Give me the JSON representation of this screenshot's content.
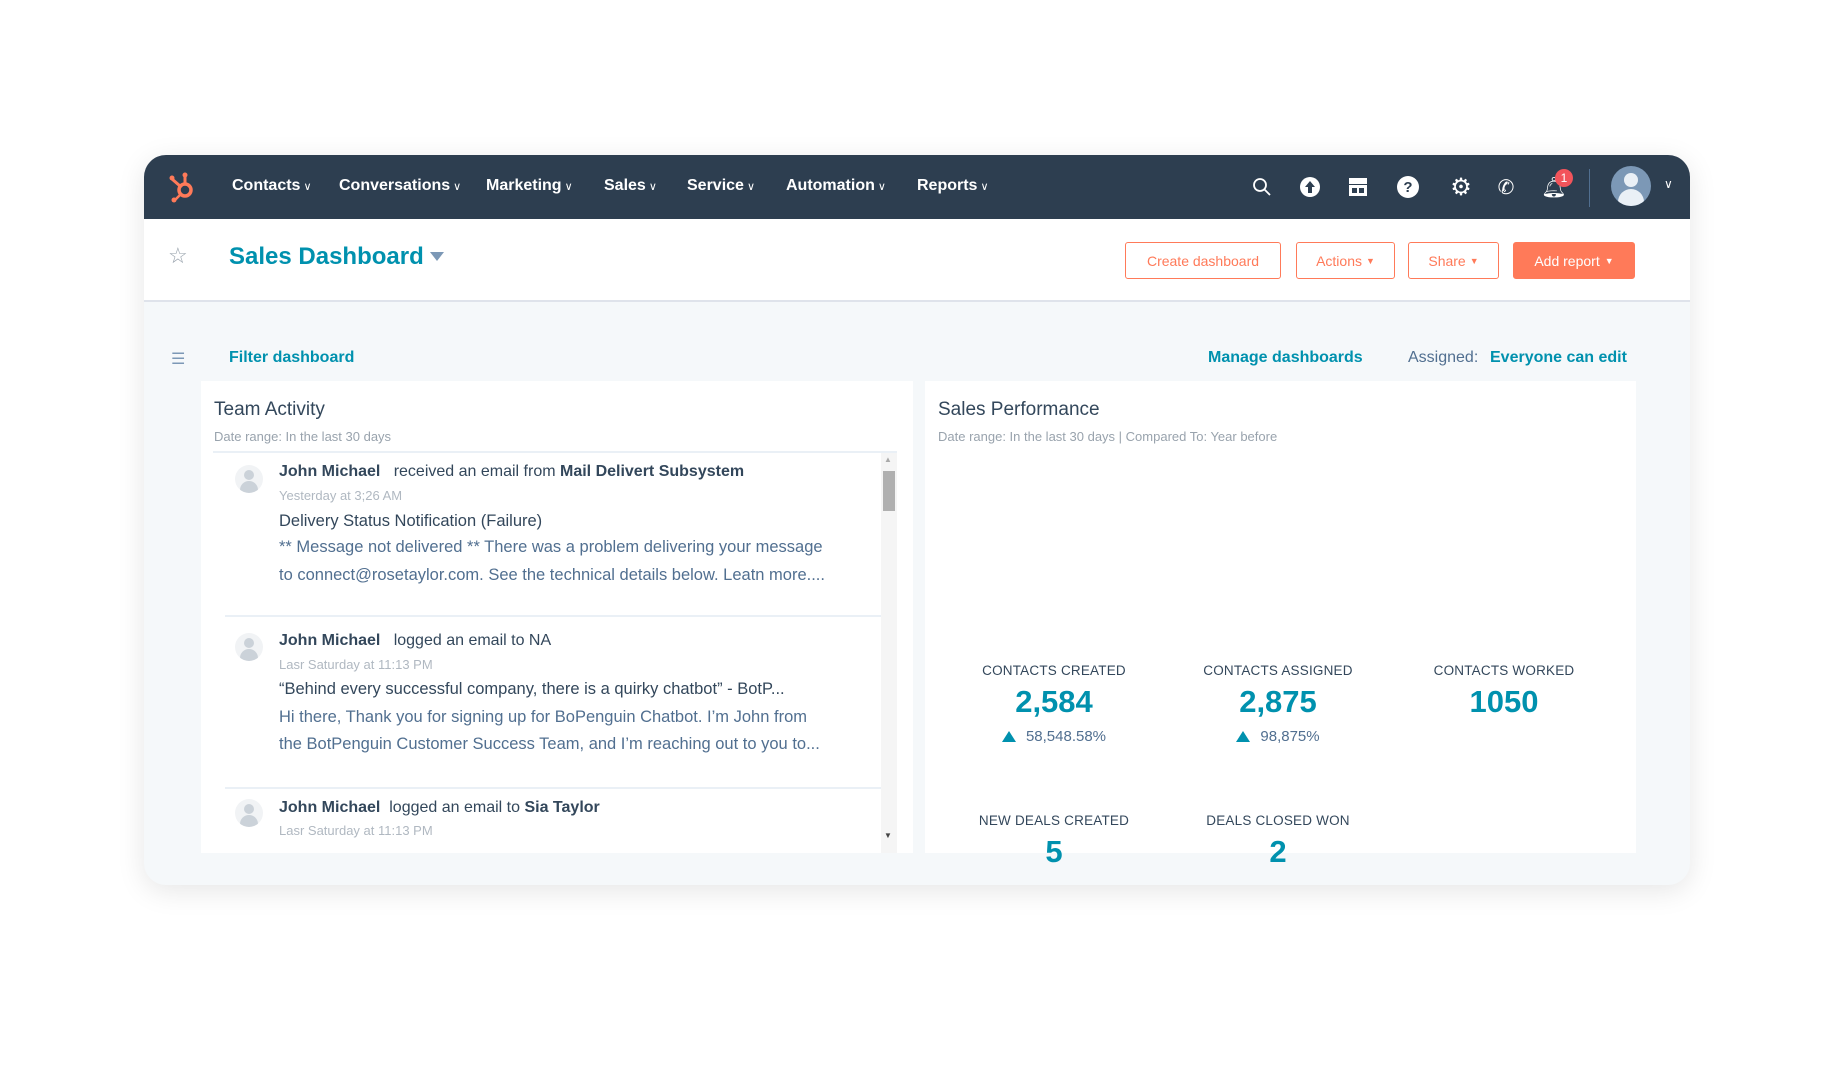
{
  "colors": {
    "nav_bg": "#2d3e50",
    "accent": "#0091ae",
    "brand": "#ff7a59",
    "body_bg": "#f5f8fa"
  },
  "nav": {
    "logo": "hubspot-logo",
    "items": [
      {
        "label": "Contacts"
      },
      {
        "label": "Conversations"
      },
      {
        "label": "Marketing"
      },
      {
        "label": "Sales"
      },
      {
        "label": "Service"
      },
      {
        "label": "Automation"
      },
      {
        "label": "Reports"
      }
    ],
    "icons": [
      "search-icon",
      "upgrade-icon",
      "marketplace-icon",
      "help-icon",
      "settings-icon",
      "calling-icon",
      "notifications-icon"
    ],
    "notification_count": "1"
  },
  "header": {
    "title": "Sales Dashboard",
    "buttons": {
      "create": "Create dashboard",
      "actions": "Actions",
      "share": "Share",
      "add_report": "Add report"
    }
  },
  "filter_bar": {
    "filter": "Filter dashboard",
    "manage": "Manage dashboards",
    "assigned_label": "Assigned:",
    "assigned_value": "Everyone can edit"
  },
  "team_activity": {
    "title": "Team Activity",
    "date_range": "Date range: In the last 30 days",
    "items": [
      {
        "name": "John Michael",
        "action": "received an email from",
        "target": "Mail Delivert Subsystem",
        "time": "Yesterday at 3;26 AM",
        "subject": "Delivery Status Notification (Failure)",
        "body1": "** Message not delivered ** There was a problem delivering your message",
        "body2": "to connect@rosetaylor.com. See the technical details below. Leatn more...."
      },
      {
        "name": "John Michael",
        "action": "logged an email to NA",
        "target": "",
        "time": "Lasr Saturday at 11:13 PM",
        "subject": "“Behind every successful company, there is a quirky chatbot” - BotP...",
        "body1": "Hi there, Thank you for signing up for BoPenguin Chatbot. I’m John from",
        "body2": "the BotPenguin Customer Success Team, and I’m reaching out to you to..."
      },
      {
        "name": "John Michael",
        "action": "logged an email to",
        "target": "Sia Taylor",
        "time": "Lasr Saturday at 11:13 PM"
      }
    ]
  },
  "sales_performance": {
    "title": "Sales Performance",
    "date_range": "Date range: In the last 30 days |  Compared To: Year before",
    "metrics": [
      {
        "label": "CONTACTS CREATED",
        "value": "2,584",
        "change": "58,548.58%"
      },
      {
        "label": "CONTACTS ASSIGNED",
        "value": "2,875",
        "change": "98,875%"
      },
      {
        "label": "CONTACTS WORKED",
        "value": "1050"
      },
      {
        "label": "NEW DEALS CREATED",
        "value": "5"
      },
      {
        "label": "DEALS CLOSED WON",
        "value": "2"
      }
    ]
  }
}
